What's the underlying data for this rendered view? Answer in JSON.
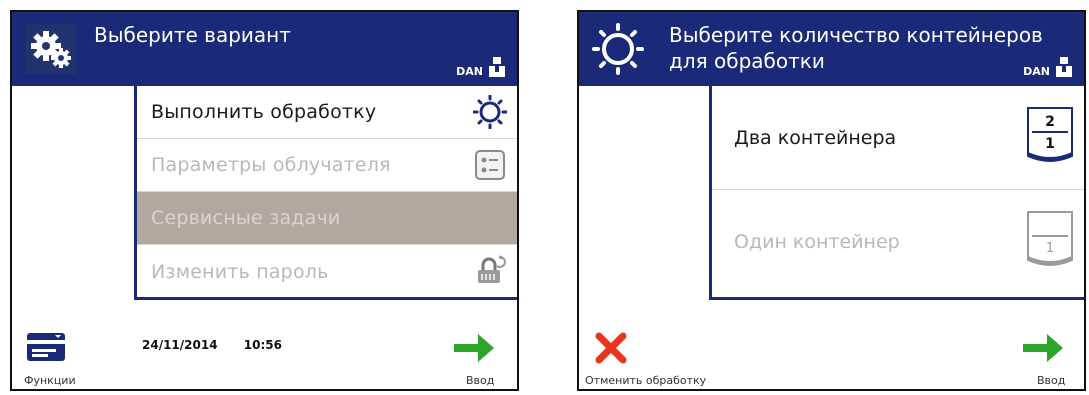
{
  "left_screen": {
    "title": "Выберите вариант",
    "user": "DAN",
    "menu": [
      {
        "label": "Выполнить обработку",
        "state": "active",
        "icon": "sun-icon"
      },
      {
        "label": "Параметры облучателя",
        "state": "disabled",
        "icon": "settings-list-icon"
      },
      {
        "label": "Сервисные задачи",
        "state": "selected",
        "icon": ""
      },
      {
        "label": "Изменить пароль",
        "state": "disabled",
        "icon": "lock-icon"
      }
    ],
    "functions_label": "Функции",
    "date": "24/11/2014",
    "time": "10:56",
    "enter_label": "Ввод"
  },
  "right_screen": {
    "title": "Выберите количество контейнеров\nдля обработки",
    "user": "DAN",
    "options": [
      {
        "label": "Два контейнера",
        "state": "active",
        "top": "2",
        "bottom": "1"
      },
      {
        "label": "Один контейнер",
        "state": "disabled",
        "top": "",
        "bottom": "1"
      }
    ],
    "cancel_label": "Отменить обработку",
    "enter_label": "Ввод"
  },
  "colors": {
    "header": "#1a2a78",
    "accent_green": "#2aa52a",
    "cancel_red": "#e8351b",
    "selected_row": "#b0a99f"
  }
}
